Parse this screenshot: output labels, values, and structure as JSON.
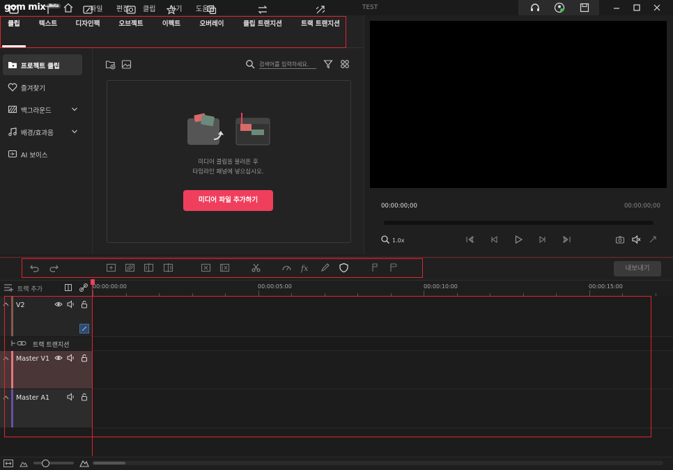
{
  "app": {
    "logo_text": "gom mix",
    "logo_badge": "Beta",
    "window_title": "TEST"
  },
  "menu": [
    "파일",
    "편집",
    "클립",
    "보기",
    "도움말"
  ],
  "tabs": [
    {
      "label": "클립",
      "icon": "clip-icon",
      "active": true
    },
    {
      "label": "텍스트",
      "icon": "text-icon"
    },
    {
      "label": "디자인팩",
      "icon": "design-pack-icon"
    },
    {
      "label": "오브젝트",
      "icon": "object-icon"
    },
    {
      "label": "이펙트",
      "icon": "effect-icon"
    },
    {
      "label": "오버레이",
      "icon": "overlay-icon"
    },
    {
      "label": "클립 트랜지션",
      "icon": "clip-transition-icon"
    },
    {
      "label": "트랙 트랜지션",
      "icon": "track-transition-icon"
    }
  ],
  "sidebar": {
    "items": [
      {
        "label": "프로젝트 클립",
        "icon": "folder-icon",
        "active": true
      },
      {
        "label": "즐겨찾기",
        "icon": "heart-icon"
      },
      {
        "label": "백그라운드",
        "icon": "background-icon",
        "expandable": true
      },
      {
        "label": "배경/효과음",
        "icon": "music-note-icon",
        "expandable": true
      },
      {
        "label": "AI 보이스",
        "icon": "ai-voice-icon"
      }
    ]
  },
  "media": {
    "search_placeholder": "검색어를 입력하세요.",
    "hint_line1": "미디어 클립을 불러온 후",
    "hint_line2": "타임라인 패널에 넣으십시오.",
    "add_button": "미디어 파일 추가하기"
  },
  "preview": {
    "current_time": "00:00:00;00",
    "total_time": "00:00:00;00",
    "zoom": "1.0x"
  },
  "timeline": {
    "add_track": "트랙 추가",
    "export_button": "내보내기",
    "ruler_labels": [
      "00:00:00:00",
      "00:00:05:00",
      "00:00:10:00",
      "00:00:15:00"
    ],
    "tracks": [
      {
        "name": "V2",
        "color": "#8a5a4a"
      },
      {
        "name": "트랙 트랜지션",
        "color": ""
      },
      {
        "name": "Master V1",
        "color": "#e8767a"
      },
      {
        "name": "Master A1",
        "color": "#6a4fa8"
      }
    ]
  },
  "colors": {
    "accent": "#ef3f5d",
    "highlight_box": "#e0242e"
  }
}
